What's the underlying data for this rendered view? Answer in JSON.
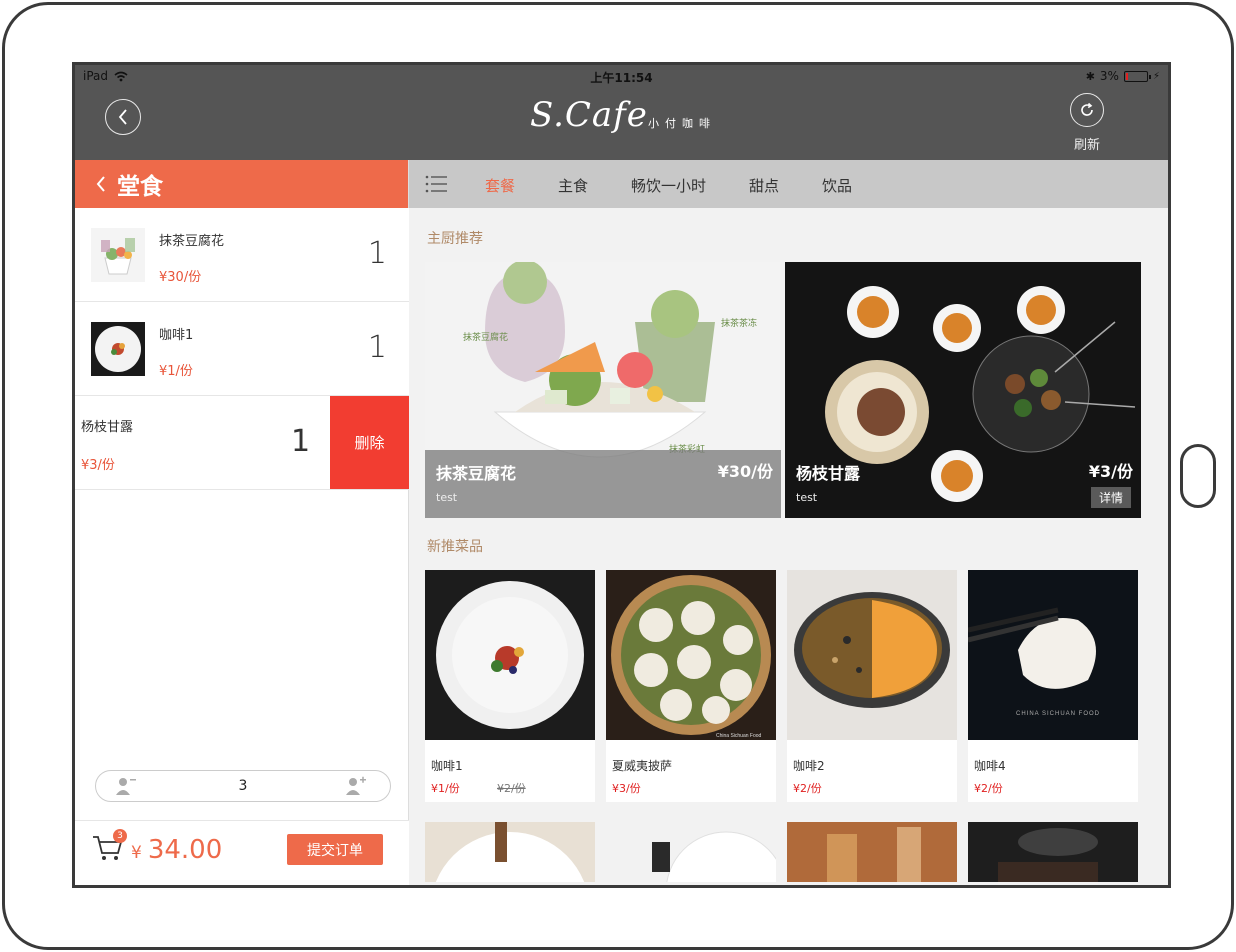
{
  "status": {
    "device": "iPad",
    "time": "上午11:54",
    "battery": "3%",
    "battery_level": 0.03
  },
  "header": {
    "logo_script": "S.Cafe",
    "logo_sub": "小付咖啡",
    "refresh_label": "刷新"
  },
  "left": {
    "title": "堂食",
    "items": [
      {
        "name": "抹茶豆腐花",
        "price": "¥30/份",
        "qty": "1"
      },
      {
        "name": "咖啡1",
        "price": "¥1/份",
        "qty": "1"
      },
      {
        "name": "杨枝甘露",
        "price": "¥3/份",
        "qty": "1"
      }
    ],
    "delete_label": "删除",
    "guests": "3",
    "cart_badge": "3",
    "currency": "¥",
    "total": "34.00",
    "submit_label": "提交订单"
  },
  "tabs": [
    "套餐",
    "主食",
    "畅饮一小时",
    "甜点",
    "饮品"
  ],
  "sections": {
    "chef": "主厨推荐",
    "new": "新推菜品"
  },
  "featured": [
    {
      "name": "抹茶豆腐花",
      "desc": "test",
      "price": "¥30/份",
      "label_1": "抹茶豆腐花",
      "label_2": "抹茶茶冻",
      "label_3": "抹茶彩虹"
    },
    {
      "name": "杨枝甘露",
      "desc": "test",
      "price": "¥3/份",
      "detail": "详情"
    }
  ],
  "dishes": [
    {
      "name": "咖啡1",
      "price": "¥1/份",
      "old_price": "¥2/份"
    },
    {
      "name": "夏威夷披萨",
      "price": "¥3/份",
      "watermark": "China Sichuan Food"
    },
    {
      "name": "咖啡2",
      "price": "¥2/份"
    },
    {
      "name": "咖啡4",
      "price": "¥2/份",
      "watermark": "CHINA SICHUAN FOOD"
    }
  ],
  "colors": {
    "accent": "#ee6a4a",
    "delete": "#f23d31",
    "nav": "#555555",
    "tabbar": "#c8c8c8",
    "section_title": "#b08a68"
  }
}
